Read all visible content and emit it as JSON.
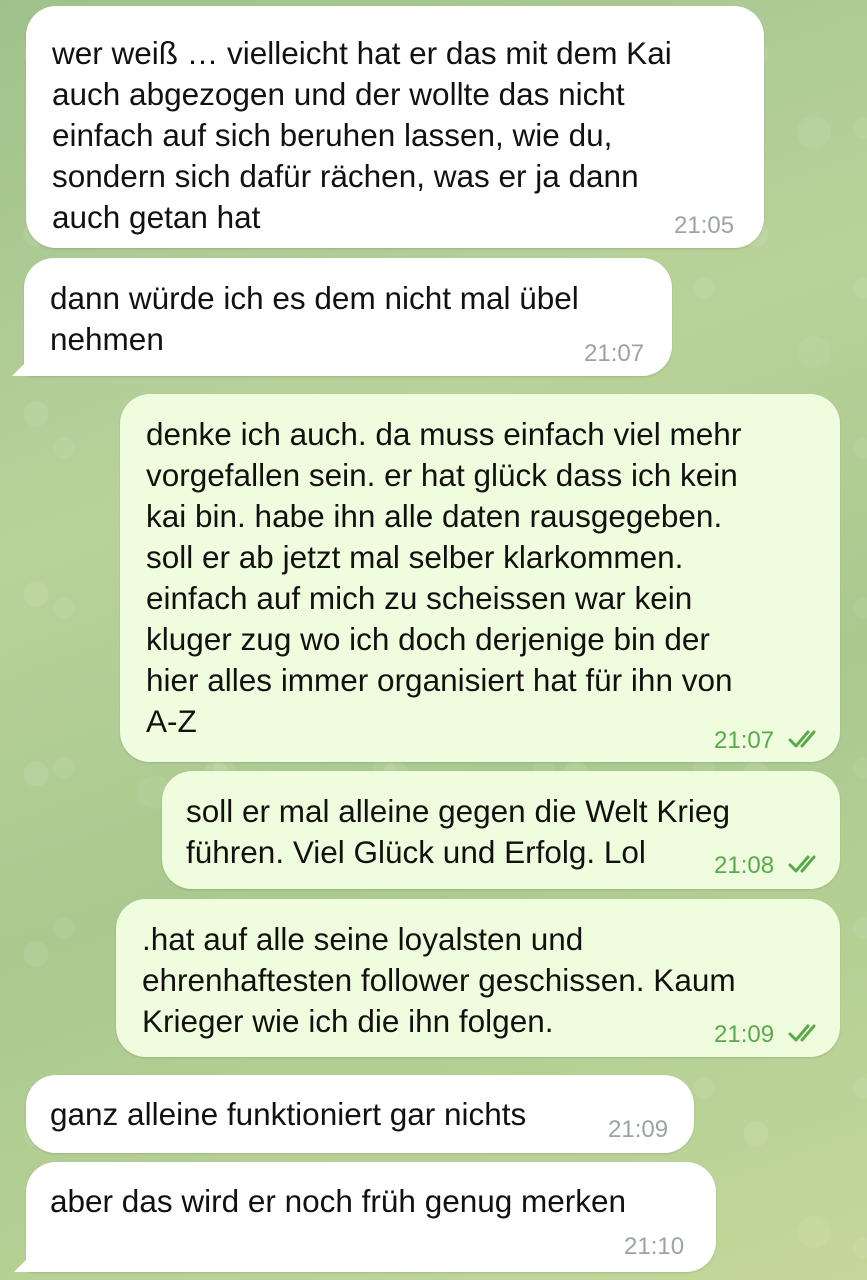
{
  "messages": [
    {
      "text": "wer weiß … vielleicht hat er das mit dem Kai\nauch abgezogen und der wollte das nicht\neinfach auf sich beruhen lassen, wie du,\nsondern sich dafür rächen, was er ja dann\nauch getan hat",
      "time": "21:05"
    },
    {
      "text": "dann würde ich es dem nicht mal übel\nnehmen",
      "time": "21:07"
    },
    {
      "text": "denke ich auch. da muss einfach viel mehr\nvorgefallen sein. er hat glück dass ich kein\nkai bin. habe ihn alle daten rausgegeben.\nsoll er ab jetzt mal selber klarkommen.\neinfach auf mich zu scheissen war kein\nkluger zug wo ich doch derjenige bin der\nhier alles immer organisiert hat für ihn von\nA-Z",
      "time": "21:07"
    },
    {
      "text": "soll er mal alleine gegen die Welt Krieg\nführen. Viel Glück und Erfolg. Lol",
      "time": "21:08"
    },
    {
      "text": ".hat auf alle seine loyalsten und\nehrenhaftesten follower geschissen. Kaum\nKrieger wie ich die ihn folgen.",
      "time": "21:09"
    },
    {
      "text": "ganz alleine funktioniert gar nichts",
      "time": "21:09"
    },
    {
      "text": "aber das wird er noch früh genug merken",
      "time": "21:10"
    }
  ],
  "colors": {
    "incoming_bubble": "#ffffff",
    "outgoing_bubble": "#effdde",
    "incoming_time": "#9aa3a8",
    "outgoing_time": "#5aa94a"
  },
  "icons": {
    "read_receipt": "double-check-icon"
  }
}
